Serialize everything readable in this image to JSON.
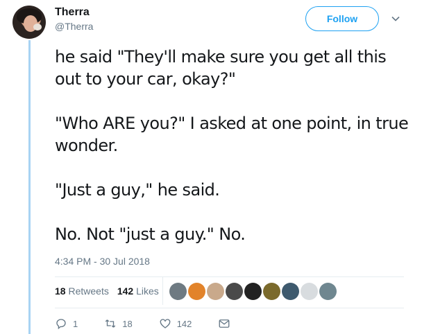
{
  "author": {
    "name": "Therra",
    "handle": "@Therra"
  },
  "follow_label": "Follow",
  "tweet": {
    "paragraphs": [
      "he said \"They'll make sure you get all this out to your car, okay?\"",
      "\"Who ARE you?\" I asked at one point, in true wonder.",
      "\"Just a guy,\" he said.",
      "No. Not \"just a guy.\" No."
    ],
    "timestamp": "4:34 PM - 30 Jul 2018"
  },
  "stats": {
    "retweets_count": "18",
    "retweets_label": "Retweets",
    "likes_count": "142",
    "likes_label": "Likes"
  },
  "likers": [
    {
      "color": "#6e7a82",
      "icon": "avatar"
    },
    {
      "color": "#e2832a",
      "icon": "avatar"
    },
    {
      "color": "#c9a98b",
      "icon": "avatar"
    },
    {
      "color": "#4a4a4a",
      "icon": "avatar"
    },
    {
      "color": "#222222",
      "icon": "avatar"
    },
    {
      "color": "#7b6a2c",
      "icon": "avatar"
    },
    {
      "color": "#3e5a6e",
      "icon": "avatar"
    },
    {
      "color": "#d8dcdf",
      "icon": "avatar"
    },
    {
      "color": "#6f8790",
      "icon": "avatar"
    }
  ],
  "actions": {
    "reply_count": "1",
    "retweet_count": "18",
    "like_count": "142"
  },
  "colors": {
    "accent": "#1da1f2",
    "muted": "#657786",
    "thread": "#a8d3f3"
  }
}
